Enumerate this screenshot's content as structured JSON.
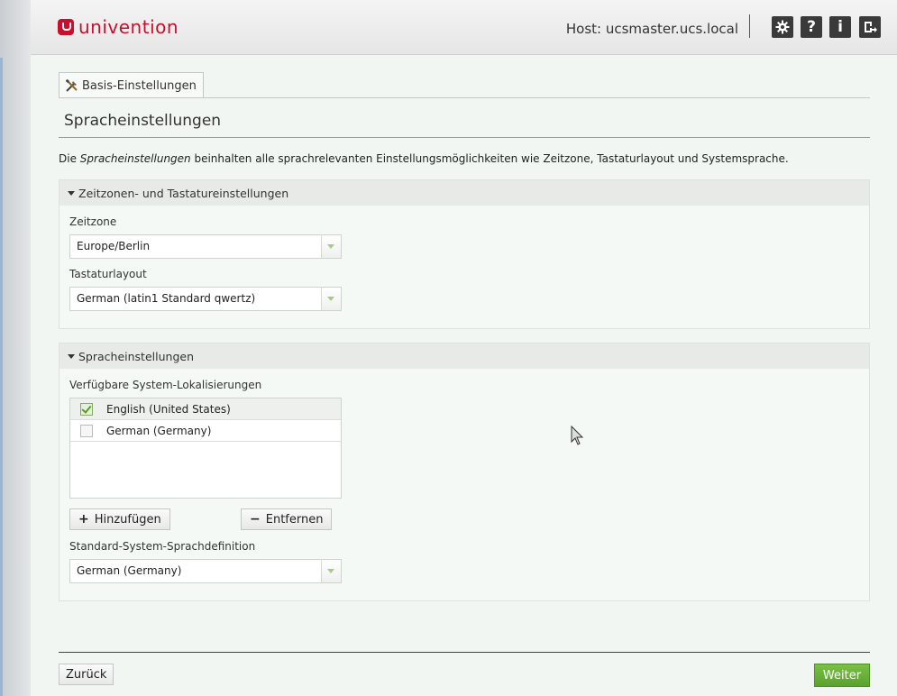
{
  "header": {
    "brand": "univention",
    "host": "Host: ucsmaster.ucs.local",
    "icons": [
      "gear-icon",
      "help-icon",
      "info-icon",
      "logout-icon"
    ],
    "help_glyph": "?",
    "info_glyph": "i"
  },
  "tab": {
    "label": "Basis-Einstellungen"
  },
  "page": {
    "title": "Spracheinstellungen",
    "description_prefix": "Die ",
    "description_emph": "Spracheinstellungen",
    "description_suffix": " beinhalten alle sprachrelevanten Einstellungsmöglichkeiten wie Zeitzone, Tastaturlayout und Systemsprache."
  },
  "timezone_section": {
    "title": "Zeitzonen- und Tastatureinstellungen",
    "timezone_label": "Zeitzone",
    "timezone_value": "Europe/Berlin",
    "keyboard_label": "Tastaturlayout",
    "keyboard_value": "German (latin1 Standard qwertz)"
  },
  "language_section": {
    "title": "Spracheinstellungen",
    "locales_label": "Verfügbare System-Lokalisierungen",
    "locales": [
      {
        "label": "English (United States)",
        "checked": true
      },
      {
        "label": "German (Germany)",
        "checked": false
      }
    ],
    "add_button": "Hinzufügen",
    "remove_button": "Entfernen",
    "default_label": "Standard-System-Sprachdefinition",
    "default_value": "German (Germany)"
  },
  "footer": {
    "back_button": "Zurück",
    "next_button": "Weiter"
  },
  "colors": {
    "brand": "#c8102e",
    "next_button": "#6cb23a"
  }
}
